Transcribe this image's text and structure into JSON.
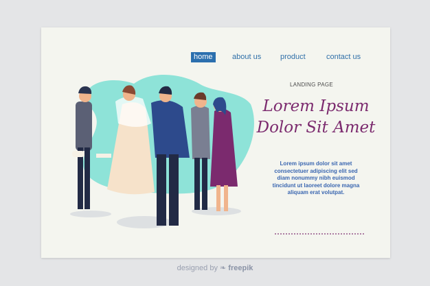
{
  "nav": {
    "items": [
      {
        "label": "home",
        "active": true
      },
      {
        "label": "about us"
      },
      {
        "label": "product"
      },
      {
        "label": "contact us"
      }
    ]
  },
  "hero": {
    "kicker": "LANDING PAGE",
    "headline_line1": "Lorem Ipsum",
    "headline_line2": "Dolor Sit Amet",
    "body": "Lorem ipsum dolor sit amet consectetuer adipiscing elit sed diam nonummy nibh euismod tincidunt ut laoreet dolore magna aliquam erat volutpat."
  },
  "footer": {
    "prefix": "designed by",
    "brand": "freepik"
  },
  "colors": {
    "accent": "#2b6fae",
    "headline": "#7b2a6e",
    "body": "#3a66b0",
    "blob": "#8ee3d8",
    "card": "#f4f5ef"
  }
}
